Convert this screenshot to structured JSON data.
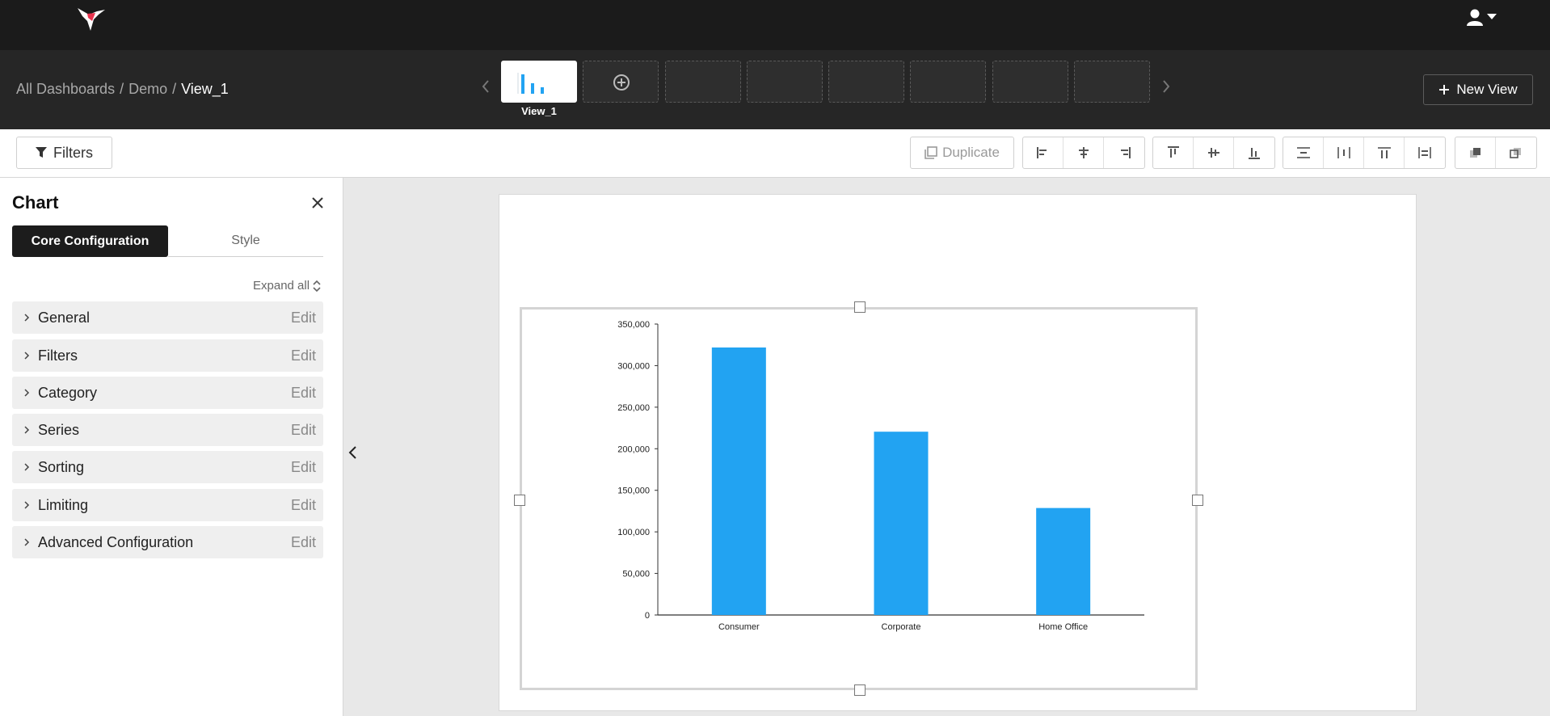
{
  "breadcrumb": {
    "root": "All Dashboards",
    "sep1": "/",
    "folder": "Demo",
    "sep2": "/",
    "current": "View_1"
  },
  "views": {
    "active_label": "View_1"
  },
  "header": {
    "new_view_label": "New View"
  },
  "toolbar": {
    "filters_label": "Filters",
    "duplicate_label": "Duplicate"
  },
  "panel": {
    "title": "Chart",
    "tabs": [
      "Core Configuration",
      "Style"
    ],
    "expand_all": "Expand all",
    "edit_label": "Edit",
    "sections": [
      "General",
      "Filters",
      "Category",
      "Series",
      "Sorting",
      "Limiting",
      "Advanced Configuration"
    ]
  },
  "colors": {
    "topbar": "#1b1b1b",
    "header": "#262626",
    "bar": "#22a3f2",
    "accent": "#e8344e"
  },
  "icons": [
    "hummingbird-logo-icon",
    "user-icon",
    "caret-down-icon",
    "plus-circle-icon",
    "plus-icon",
    "filter-icon",
    "duplicate-icon",
    "close-icon",
    "chevron-right-icon",
    "expand-icon",
    "chevron-left-icon"
  ],
  "chart_data": {
    "type": "bar",
    "categories": [
      "Consumer",
      "Corporate",
      "Home Office"
    ],
    "values": [
      321800,
      220500,
      128700
    ],
    "ylim": [
      0,
      350000
    ],
    "yticks": [
      "0",
      "50,000",
      "100,000",
      "150,000",
      "200,000",
      "250,000",
      "300,000",
      "350,000"
    ],
    "ytick_values": [
      0,
      50000,
      100000,
      150000,
      200000,
      250000,
      300000,
      350000
    ],
    "title": "",
    "xlabel": "",
    "ylabel": "",
    "grid": false,
    "legend": "none"
  }
}
